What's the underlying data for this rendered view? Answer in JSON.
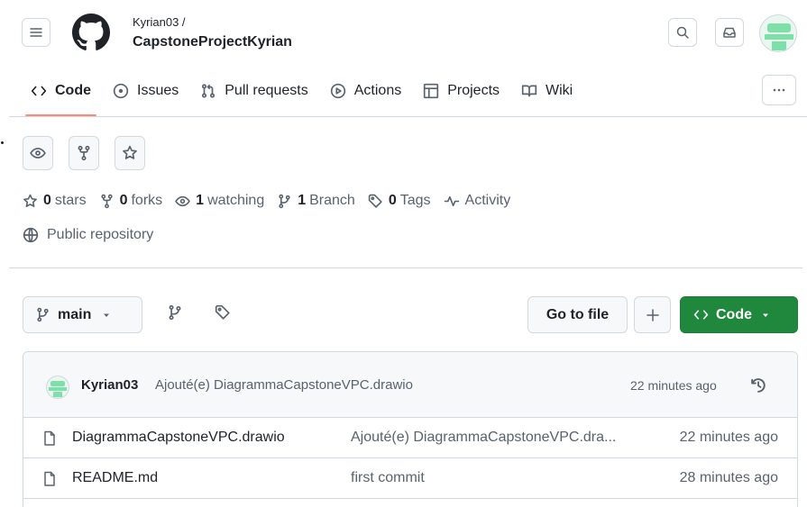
{
  "header": {
    "owner": "Kyrian03 /",
    "repo": "CapstoneProjectKyrian"
  },
  "nav": {
    "tabs": [
      {
        "label": "Code",
        "icon": "code-icon",
        "active": true
      },
      {
        "label": "Issues",
        "icon": "issue-icon"
      },
      {
        "label": "Pull requests",
        "icon": "pull-request-icon"
      },
      {
        "label": "Actions",
        "icon": "play-icon"
      },
      {
        "label": "Projects",
        "icon": "table-icon"
      },
      {
        "label": "Wiki",
        "icon": "book-icon"
      }
    ]
  },
  "stats": {
    "stars_count": "0",
    "stars_label": "stars",
    "forks_count": "0",
    "forks_label": "forks",
    "watching_count": "1",
    "watching_label": "watching",
    "branch_count": "1",
    "branch_label": "Branch",
    "tags_count": "0",
    "tags_label": "Tags",
    "activity_label": "Activity",
    "visibility": "Public repository"
  },
  "toolbar": {
    "branch": "main",
    "go_to_file": "Go to file",
    "code_label": "Code"
  },
  "latest_commit": {
    "author": "Kyrian03",
    "message": "Ajouté(e) DiagrammaCapstoneVPC.drawio",
    "time": "22 minutes ago"
  },
  "files": [
    {
      "name": "DiagrammaCapstoneVPC.drawio",
      "message": "Ajouté(e) DiagrammaCapstoneVPC.dra...",
      "time": "22 minutes ago"
    },
    {
      "name": "README.md",
      "message": "first commit",
      "time": "28 minutes ago"
    }
  ],
  "colors": {
    "accent_green": "#1f883d",
    "tab_underline": "#fd8c73",
    "avatar_green": "#7ee0a8"
  }
}
